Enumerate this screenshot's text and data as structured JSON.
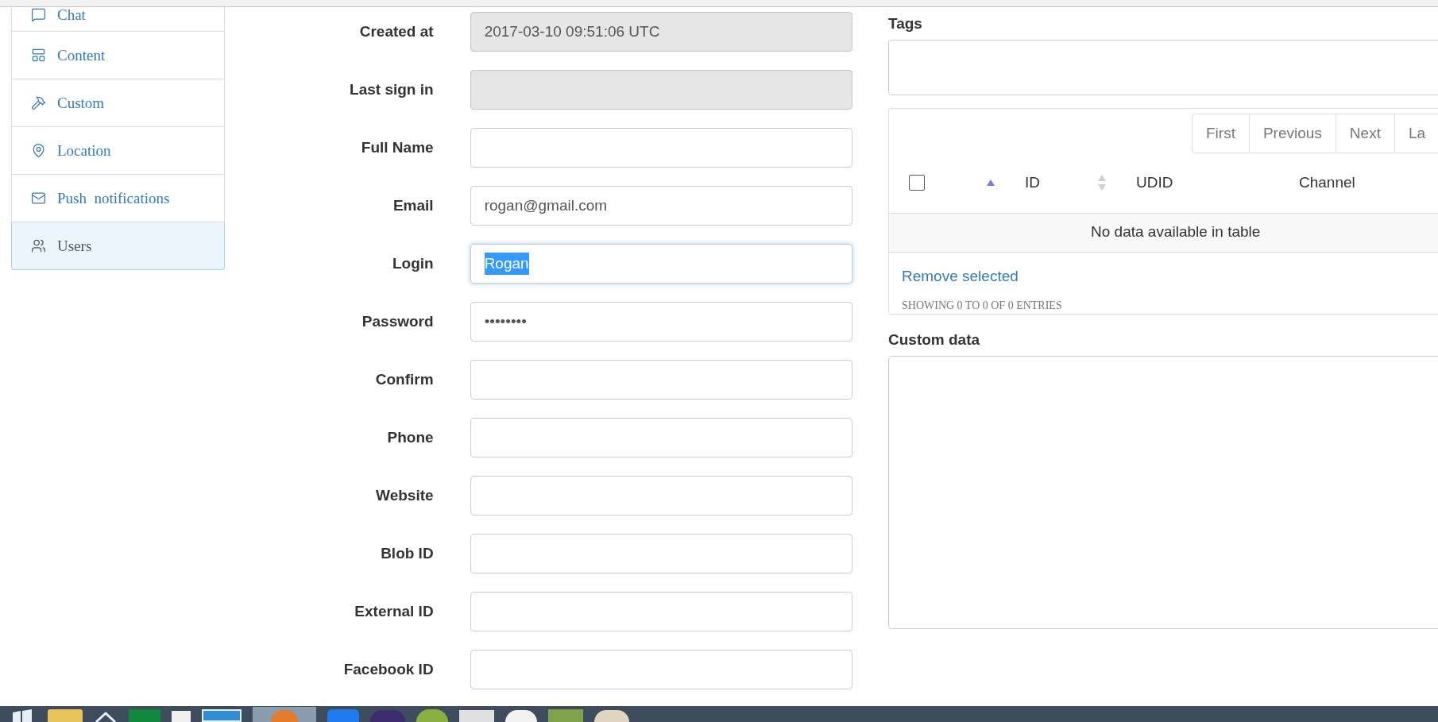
{
  "sidebar": {
    "items": [
      {
        "label": "Chat",
        "selected": false
      },
      {
        "label": "Content",
        "selected": false
      },
      {
        "label": "Custom",
        "selected": false
      },
      {
        "label": "Location",
        "selected": false
      },
      {
        "label": "Push  notifications",
        "selected": false
      },
      {
        "label": "Users",
        "selected": true
      }
    ]
  },
  "form": {
    "fields": [
      {
        "label": "Created at",
        "value": "2017-03-10 09:51:06 UTC",
        "disabled": true,
        "focused": false
      },
      {
        "label": "Last sign in",
        "disabled": true,
        "focused": false
      },
      {
        "label": "Full Name",
        "disabled": false,
        "focused": false
      },
      {
        "label": "Email",
        "value": "rogan@gmail.com",
        "disabled": false,
        "focused": false
      },
      {
        "label": "Login",
        "value": "Rogan",
        "disabled": false,
        "focused": true,
        "highlighted": true
      },
      {
        "label": "Password",
        "value": "••••••••",
        "disabled": false,
        "focused": false
      },
      {
        "label": "Confirm",
        "disabled": false,
        "focused": false
      },
      {
        "label": "Phone",
        "disabled": false,
        "focused": false
      },
      {
        "label": "Website",
        "disabled": false,
        "focused": false
      },
      {
        "label": "Blob ID",
        "disabled": false,
        "focused": false
      },
      {
        "label": "External ID",
        "disabled": false,
        "focused": false
      },
      {
        "label": "Facebook ID",
        "disabled": false,
        "focused": false
      }
    ]
  },
  "tags": {
    "label": "Tags"
  },
  "devices": {
    "pagination": [
      "First",
      "Previous",
      "Next",
      "La"
    ],
    "select_all": {
      "checked": false,
      "sorted_ascending": true
    },
    "columns": [
      {
        "label": "ID",
        "sortable": true
      },
      {
        "label": "UDID",
        "sortable": false
      },
      {
        "label": "Channel",
        "sortable": false
      }
    ],
    "empty_message": "No data available in table",
    "remove_link": "Remove selected",
    "info": "SHOWING 0 TO 0 OF 0 ENTRIES"
  },
  "custom_data": {
    "label": "Custom data"
  }
}
